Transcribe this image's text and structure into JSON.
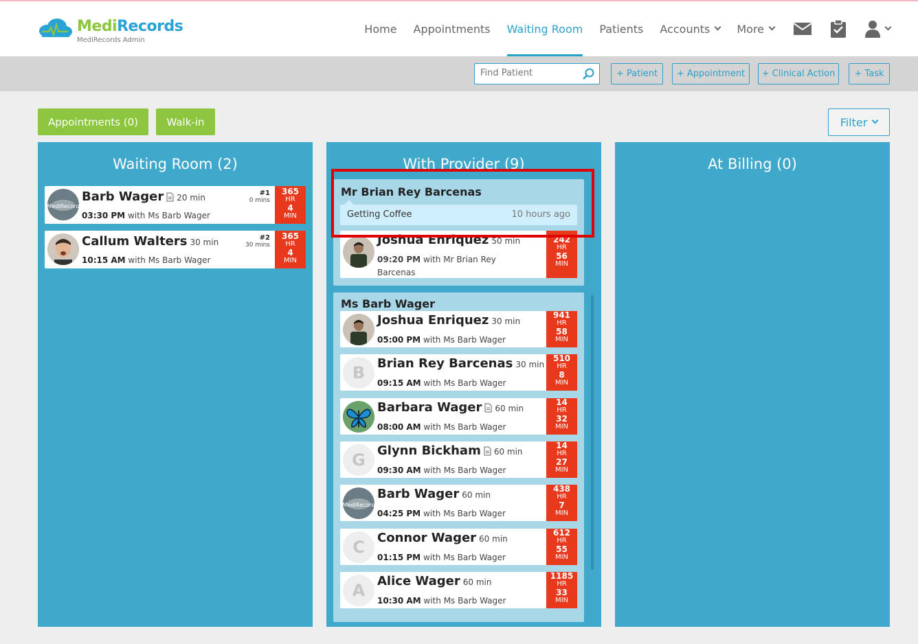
{
  "brand": {
    "name_a": "Medi",
    "name_b": "Records",
    "subtitle": "MediRecords Admin"
  },
  "nav": {
    "items": [
      {
        "label": "Home",
        "active": false
      },
      {
        "label": "Appointments",
        "active": false
      },
      {
        "label": "Waiting Room",
        "active": true
      },
      {
        "label": "Patients",
        "active": false
      },
      {
        "label": "Accounts",
        "active": false
      },
      {
        "label": "More",
        "active": false
      }
    ],
    "icons": [
      "mail-icon",
      "clipboard-check-icon",
      "user-icon"
    ]
  },
  "toolbar": {
    "search_placeholder": "Find Patient",
    "add_patient": "+ Patient",
    "add_appointment": "+ Appointment",
    "add_clinical_action": "+ Clinical Action",
    "add_task": "+ Task"
  },
  "actions": {
    "appointments": "Appointments (0)",
    "walkin": "Walk-in",
    "filter": "Filter"
  },
  "columns": {
    "waiting": {
      "title": "Waiting Room (2)",
      "cards": [
        {
          "name": "Barb Wager",
          "duration": "20 min",
          "has_doc": true,
          "queue": "#1",
          "queue_wait": "0 mins",
          "time": "03:30 PM",
          "with": " with Ms Barb Wager",
          "timer_hr": "365",
          "timer_min": "4",
          "avatar": "logo"
        },
        {
          "name": "Callum Walters",
          "duration": "30 min",
          "has_doc": false,
          "queue": "#2",
          "queue_wait": "30 mins",
          "time": "10:15 AM",
          "with": " with Ms Barb Wager",
          "timer_hr": "365",
          "timer_min": "4",
          "avatar": "photo"
        }
      ]
    },
    "provider": {
      "title": "With Provider (9)",
      "group1": {
        "provider": "Mr Brian Rey Barcenas",
        "note": "Getting Coffee",
        "note_time": "10 hours ago",
        "cards": [
          {
            "name": "Joshua Enriquez",
            "duration": "50 min",
            "time": "09:20 PM",
            "with": " with Mr Brian Rey Barcenas",
            "timer_hr": "242",
            "timer_min": "56"
          }
        ]
      },
      "group2": {
        "provider": "Ms Barb Wager",
        "cards": [
          {
            "name": "Joshua Enriquez",
            "duration": "30 min",
            "time": "05:00 PM",
            "with": " with Ms Barb Wager",
            "timer_hr": "941",
            "timer_min": "58",
            "avatar": "photo",
            "letter": ""
          },
          {
            "name": "Brian Rey Barcenas",
            "duration": "30 min",
            "time": "09:15 AM",
            "with": " with Ms Barb Wager",
            "timer_hr": "510",
            "timer_min": "8",
            "avatar": "letter",
            "letter": "B"
          },
          {
            "name": "Barbara Wager",
            "duration": "60 min",
            "time": "08:00 AM",
            "with": " with Ms Barb Wager",
            "timer_hr": "14",
            "timer_min": "32",
            "avatar": "butterfly",
            "letter": ""
          },
          {
            "name": "Glynn Bickham",
            "duration": "60 min",
            "time": "09:30 AM",
            "with": " with Ms Barb Wager",
            "timer_hr": "14",
            "timer_min": "27",
            "avatar": "letter",
            "letter": "G"
          },
          {
            "name": "Barb Wager",
            "duration": "60 min",
            "time": "04:25 PM",
            "with": " with Ms Barb Wager",
            "timer_hr": "438",
            "timer_min": "7",
            "avatar": "logo",
            "letter": ""
          },
          {
            "name": "Connor Wager",
            "duration": "60 min",
            "time": "01:15 PM",
            "with": " with Ms Barb Wager",
            "timer_hr": "612",
            "timer_min": "55",
            "avatar": "letter",
            "letter": "C"
          },
          {
            "name": "Alice Wager",
            "duration": "60 min",
            "time": "10:30 AM",
            "with": " with Ms Barb Wager",
            "timer_hr": "1185",
            "timer_min": "33",
            "avatar": "letter",
            "letter": "A"
          }
        ]
      }
    },
    "billing": {
      "title": "At Billing (0)"
    }
  },
  "timer_labels": {
    "hr": "HR",
    "min": "MIN"
  },
  "colors": {
    "accent": "#2aa1c9",
    "column": "#3fa8cb",
    "green": "#8cc63f",
    "timer": "#e8391d",
    "group": "#a8d7e7",
    "highlight": "#e00000"
  }
}
